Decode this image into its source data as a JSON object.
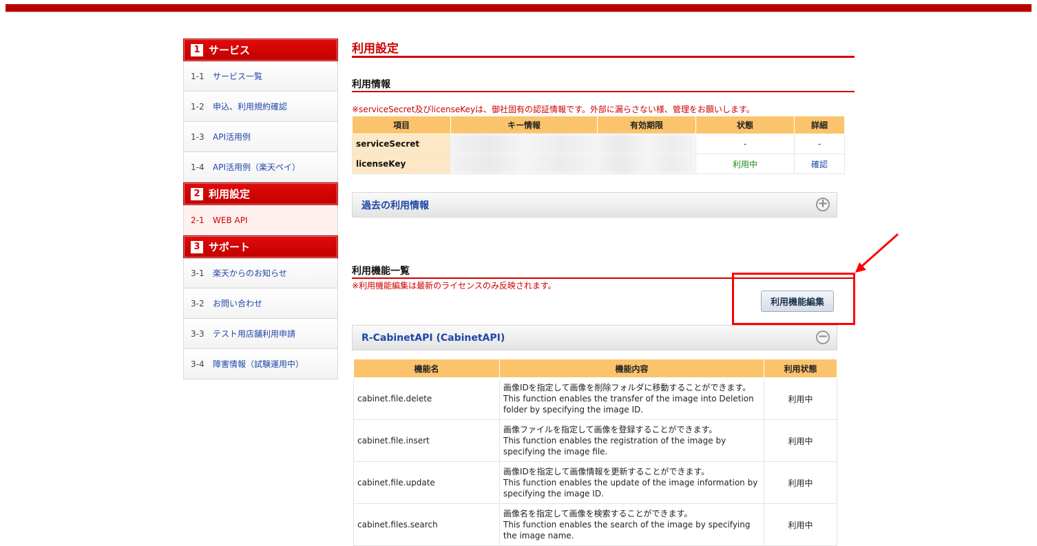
{
  "sidebar": {
    "sections": [
      {
        "num": "1",
        "title": "サービス",
        "items": [
          {
            "num": "1-1",
            "label": "サービス一覧"
          },
          {
            "num": "1-2",
            "label": "申込、利用規約確認"
          },
          {
            "num": "1-3",
            "label": "API活用例"
          },
          {
            "num": "1-4",
            "label": "API活用例（楽天ペイ）"
          }
        ]
      },
      {
        "num": "2",
        "title": "利用設定",
        "items": [
          {
            "num": "2-1",
            "label": "WEB API"
          }
        ]
      },
      {
        "num": "3",
        "title": "サポート",
        "items": [
          {
            "num": "3-1",
            "label": "楽天からのお知らせ"
          },
          {
            "num": "3-2",
            "label": "お問い合わせ"
          },
          {
            "num": "3-3",
            "label": "テスト用店舗利用申請"
          },
          {
            "num": "3-4",
            "label": "障害情報（試験運用中）"
          }
        ]
      }
    ]
  },
  "main": {
    "page_title": "利用設定",
    "usage_info": {
      "heading": "利用情報",
      "note": "※serviceSecret及びlicenseKeyは、御社固有の認証情報です。外部に漏らさない様、管理をお願いします。",
      "columns": [
        "項目",
        "キー情報",
        "有効期限",
        "状態",
        "詳細"
      ],
      "rows": [
        {
          "item": "serviceSecret",
          "status": "-",
          "detail": "-"
        },
        {
          "item": "licenseKey",
          "status": "利用中",
          "detail": "確認"
        }
      ]
    },
    "past_panel_title": "過去の利用情報",
    "functions": {
      "heading": "利用機能一覧",
      "note": "※利用機能編集は最新のライセンスのみ反映されます。",
      "edit_button": "利用機能編集",
      "api_panel_title": "R-CabinetAPI (CabinetAPI)",
      "columns": [
        "機能名",
        "機能内容",
        "利用状態"
      ],
      "rows": [
        {
          "name": "cabinet.file.delete",
          "desc1": "画像IDを指定して画像を削除フォルダに移動することができます。",
          "desc2": "This function enables the transfer of the image into Deletion",
          "desc3": "folder by specifying the image ID.",
          "status": "利用中"
        },
        {
          "name": "cabinet.file.insert",
          "desc1": "画像ファイルを指定して画像を登録することができます。",
          "desc2": "This function enables the registration of the image by",
          "desc3": "specifying the image file.",
          "status": "利用中"
        },
        {
          "name": "cabinet.file.update",
          "desc1": "画像IDを指定して画像情報を更新することができます。",
          "desc2": "This function enables the update of the image information by",
          "desc3": "specifying the image ID.",
          "status": "利用中"
        },
        {
          "name": "cabinet.files.search",
          "desc1": "画像名を指定して画像を検索することができます。",
          "desc2": "This function enables the search of the image by specifying",
          "desc3": "the image name.",
          "status": "利用中"
        }
      ]
    }
  },
  "colors": {
    "brand_red": "#d00000",
    "header_orange": "#fbc46c",
    "link_blue": "#1f47a8",
    "status_green": "#1a8a1a"
  }
}
